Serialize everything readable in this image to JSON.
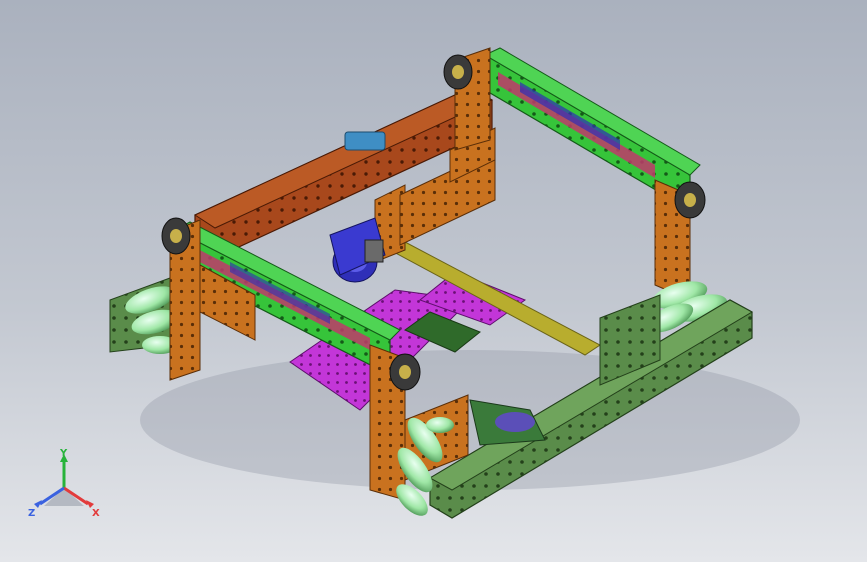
{
  "viewport": {
    "background_top": "#aab1be",
    "background_bottom": "#e4e6ea"
  },
  "model": {
    "colors": {
      "green": "#36c43a",
      "green_dark": "#1f8a25",
      "orange": "#c9721f",
      "orange_dark": "#8f4d12",
      "brown": "#a8481c",
      "magenta": "#c336d8",
      "olive": "#8f8a2a",
      "olive_green": "#5a8c4a",
      "wheel_roller": "#9fe7a6",
      "pulley": "#3a3a3a",
      "motor": "#3a3ad0"
    },
    "icon": "robot-chassis-3d"
  },
  "triad": {
    "x_label": "X",
    "y_label": "Y",
    "z_label": "Z",
    "x_color": "#e23b3b",
    "y_color": "#27b33a",
    "z_color": "#3a62e0"
  }
}
